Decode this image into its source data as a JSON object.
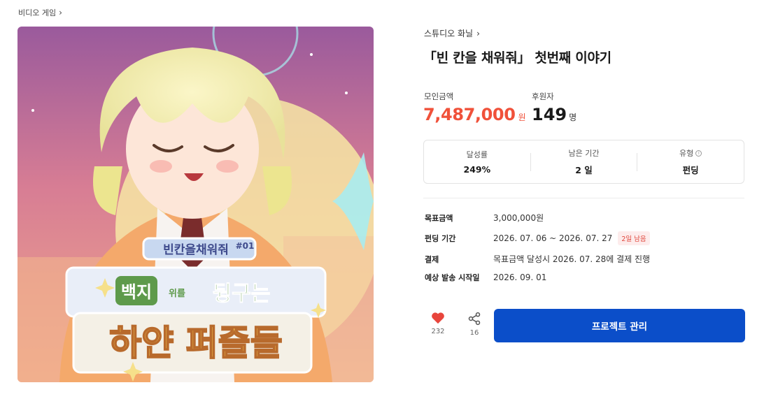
{
  "breadcrumb": {
    "category": "비디오 게임"
  },
  "project": {
    "creator": "스튜디오 화닐",
    "title": "「빈 칸을 채워줘」 첫번째 이야기"
  },
  "hero_art": {
    "series_title": "빈칸을채워줘",
    "episode": "#01",
    "subtitle_1": "백지",
    "subtitle_particle": "위를",
    "subtitle_2": "뒹구는",
    "main_title": "하얀 퍼즐들"
  },
  "stats": {
    "amount_label": "모인금액",
    "amount_value": "7,487,000",
    "amount_unit": "원",
    "backers_label": "후원자",
    "backers_value": "149",
    "backers_unit": "명"
  },
  "summary": {
    "achievement_label": "달성률",
    "achievement_value": "249%",
    "remaining_label": "남은 기간",
    "remaining_value": "2 일",
    "type_label": "유형",
    "type_value": "펀딩"
  },
  "details": {
    "goal_label": "목표금액",
    "goal_value": "3,000,000원",
    "period_label": "펀딩 기간",
    "period_value": "2026. 07. 06 ~ 2026. 07. 27",
    "period_badge": "2일 남음",
    "payment_label": "결제",
    "payment_value": "목표금액 달성시 2026. 07. 28에 결제 진행",
    "delivery_label": "예상 발송 시작일",
    "delivery_value": "2026. 09. 01"
  },
  "actions": {
    "like_count": "232",
    "share_count": "16",
    "cta_label": "프로젝트 관리"
  },
  "colors": {
    "accent_red": "#f0513a",
    "primary_blue": "#0b4ec9",
    "like_red": "#e8453c"
  }
}
